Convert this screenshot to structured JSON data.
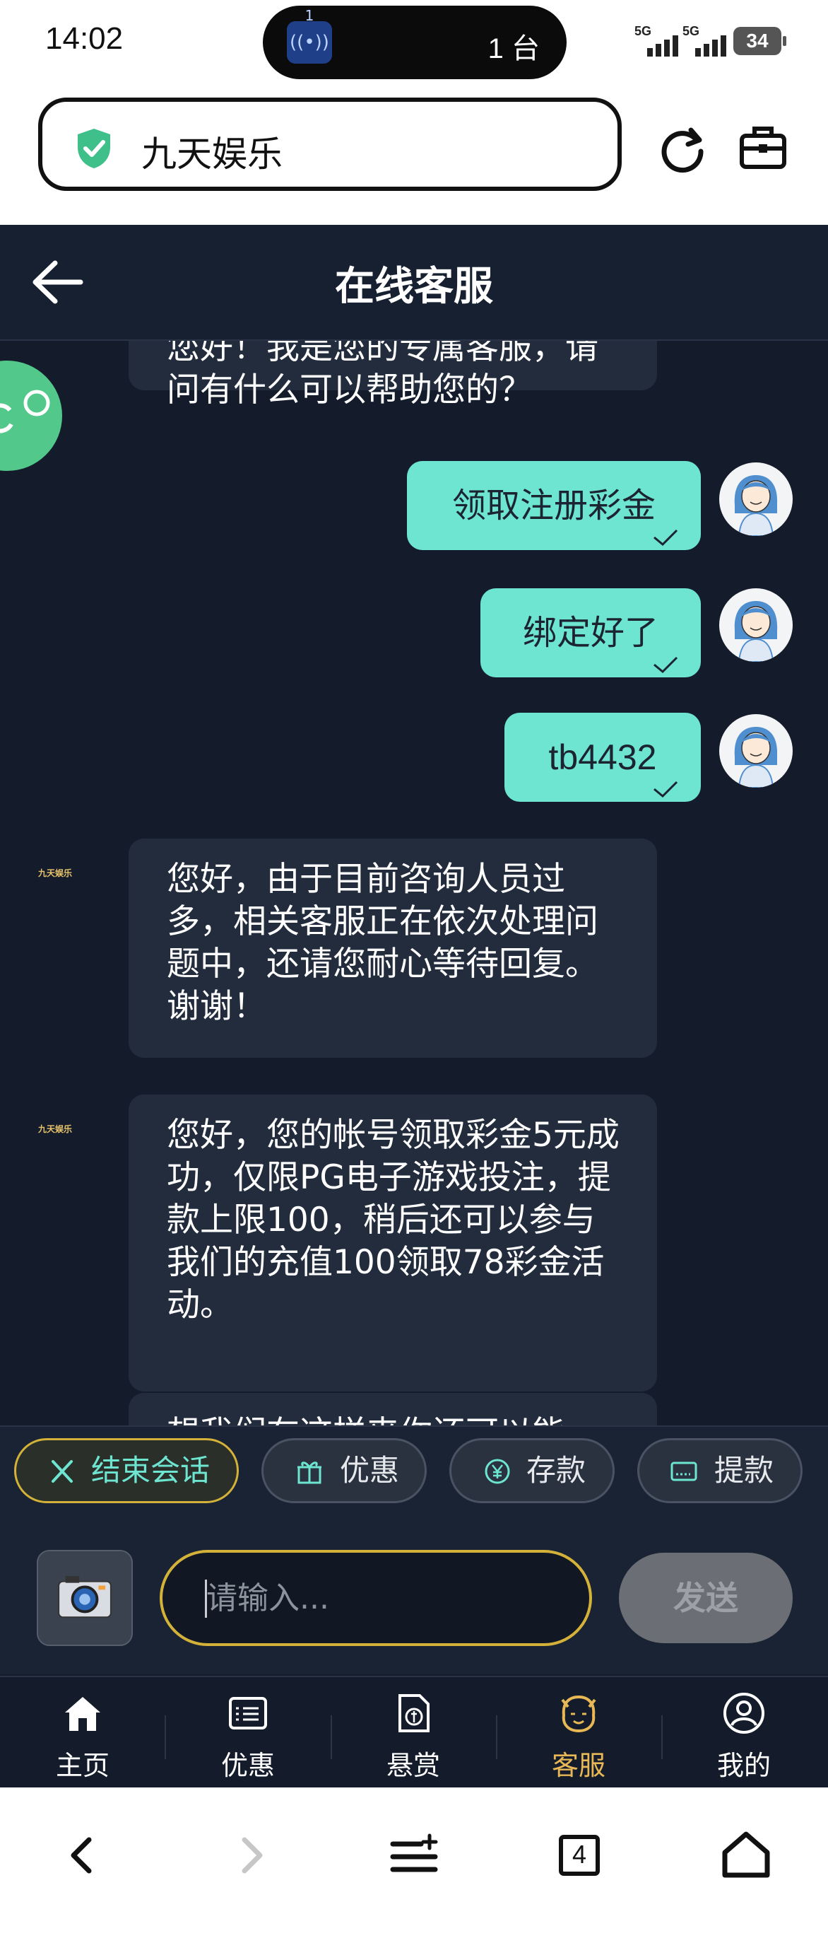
{
  "status_bar": {
    "time": "14:02",
    "island_badge": "1",
    "island_text": "1 台",
    "signal_1": "5G",
    "signal_2": "5G",
    "battery": "34"
  },
  "browser": {
    "site_name": "九天娱乐"
  },
  "chat": {
    "title": "在线客服",
    "brand_small": "九天娱乐",
    "messages": [
      {
        "side": "left",
        "text": "您好！我是您的专属客服，请问有什么可以帮助您的？"
      },
      {
        "side": "right",
        "text": "领取注册彩金"
      },
      {
        "side": "right",
        "text": "绑定好了"
      },
      {
        "side": "right",
        "text": "tb4432"
      },
      {
        "side": "left",
        "text": "您好，由于目前咨询人员过多，相关客服正在依次处理问题中，还请您耐心等待回复。谢谢！"
      },
      {
        "side": "left",
        "text": "您好，您的帐号领取彩金5元成功，仅限PG电子游戏投注，提款上限100，稍后还可以参与我们的充值100领取78彩金活动。"
      },
      {
        "side": "left",
        "text": "想我们在这样来你还可以能"
      }
    ]
  },
  "quick_actions": {
    "end": "结束会话",
    "promo": "优惠",
    "deposit": "存款",
    "withdraw": "提款"
  },
  "composer": {
    "placeholder": "请输入...",
    "send": "发送"
  },
  "tabs": {
    "home": "主页",
    "promo": "优惠",
    "reward": "悬赏",
    "service": "客服",
    "mine": "我的"
  },
  "system_nav": {
    "tabs_count": "4"
  },
  "colors": {
    "accent_teal": "#6ee5d0",
    "accent_gold": "#d4b23a",
    "background": "#141c2b"
  }
}
